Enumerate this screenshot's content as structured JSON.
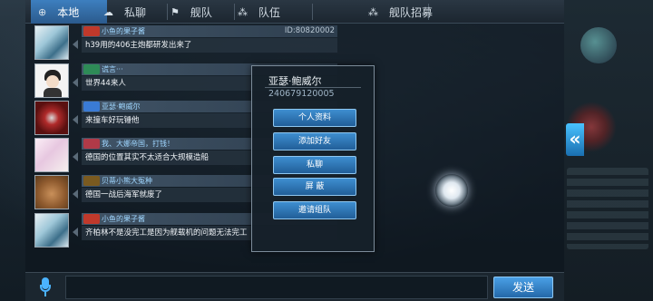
{
  "tabs": [
    {
      "label": "本地",
      "icon": "globe-icon",
      "glyph": "⊕",
      "active": true
    },
    {
      "label": "私聊",
      "icon": "chat-bubble-icon",
      "glyph": "☁",
      "active": false
    },
    {
      "label": "舰队",
      "icon": "fleet-icon",
      "glyph": "⚑",
      "active": false
    },
    {
      "label": "队伍",
      "icon": "team-icon",
      "glyph": "⁂",
      "active": false
    },
    {
      "label": "舰队招募",
      "icon": "recruit-icon",
      "glyph": "⁂",
      "active": false
    }
  ],
  "messages": [
    {
      "name": "小鱼的果子酱",
      "uid": "ID:80820002",
      "text": "h39用的406主炮都研发出来了",
      "badge_color": "#c0392b",
      "avatar": "anime-avatar-icon"
    },
    {
      "name": "谎言···",
      "uid": "",
      "text": "世界44来人",
      "badge_color": "#2e8b57",
      "avatar": "cartoon-boy-avatar-icon"
    },
    {
      "name": "亚瑟·鲍威尔",
      "uid": "",
      "text": "来撞车好玩锤他",
      "badge_color": "#3a7bd5",
      "avatar": "emblem-avatar-icon"
    },
    {
      "name": "我、大娜帝国，打钱！",
      "uid": "",
      "text": "德国的位置其实不太适合大规模造船",
      "badge_color": "#b03a48",
      "avatar": "anime-girl-avatar-icon"
    },
    {
      "name": "贝蒂小熊大冤种",
      "uid": "",
      "text": "德国一战后海军就废了",
      "badge_color": "#7a5a20",
      "avatar": "teddy-bear-avatar-icon"
    },
    {
      "name": "小鱼的果子酱",
      "uid": "",
      "text": "齐柏林不是没完工是因为舰载机的问题无法完工",
      "badge_color": "#c0392b",
      "avatar": "anime-avatar-icon"
    }
  ],
  "context_menu": {
    "name": "亚瑟·鲍威尔",
    "id": "240679120005",
    "buttons": [
      "个人资料",
      "添加好友",
      "私聊",
      "屏 蔽",
      "邀请组队"
    ]
  },
  "input": {
    "value": ""
  },
  "send_label": "发送"
}
